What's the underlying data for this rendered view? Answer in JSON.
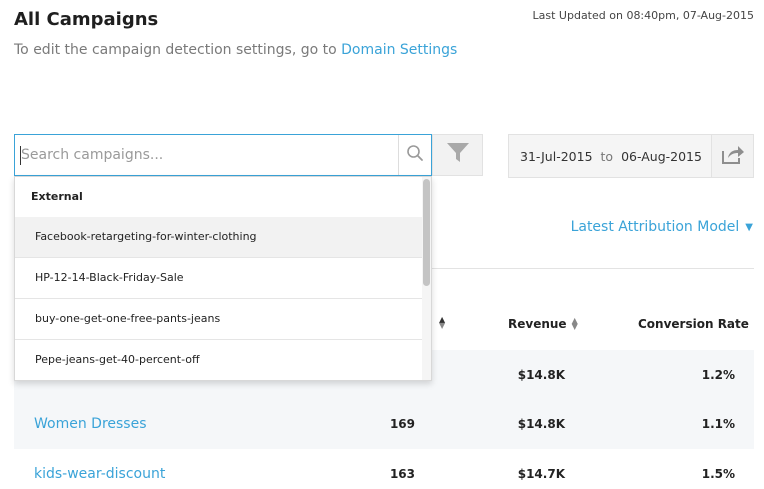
{
  "header": {
    "title": "All Campaigns",
    "last_updated": "Last Updated on 08:40pm, 07-Aug-2015",
    "subtitle_prefix": "To edit the campaign detection settings, go to ",
    "subtitle_link": "Domain Settings"
  },
  "search": {
    "placeholder": "Search campaigns...",
    "value": "",
    "icon": "search-icon"
  },
  "filter": {
    "icon": "filter-icon"
  },
  "date_range": {
    "start": "31-Jul-2015",
    "separator": "to",
    "end": "06-Aug-2015",
    "share_icon": "share-icon"
  },
  "dropdown": {
    "group_label": "External",
    "items": [
      "Facebook-retargeting-for-winter-clothing",
      "HP-12-14-Black-Friday-Sale",
      "buy-one-get-one-free-pants-jeans",
      "Pepe-jeans-get-40-percent-off"
    ],
    "highlighted_index": 0
  },
  "attribution": {
    "label": "Latest Attribution Model"
  },
  "table": {
    "columns": {
      "revenue": "Revenue",
      "conversion": "Conversion Rate"
    },
    "rows": [
      {
        "name": "",
        "visits": "",
        "revenue": "$14.8K",
        "conversion": "1.2%"
      },
      {
        "name": "Women Dresses",
        "visits": "169",
        "revenue": "$14.8K",
        "conversion": "1.1%"
      },
      {
        "name": "kids-wear-discount",
        "visits": "163",
        "revenue": "$14.7K",
        "conversion": "1.5%"
      }
    ]
  },
  "colors": {
    "accent": "#3aa3d8",
    "row_alt": "#f5f7f9"
  }
}
